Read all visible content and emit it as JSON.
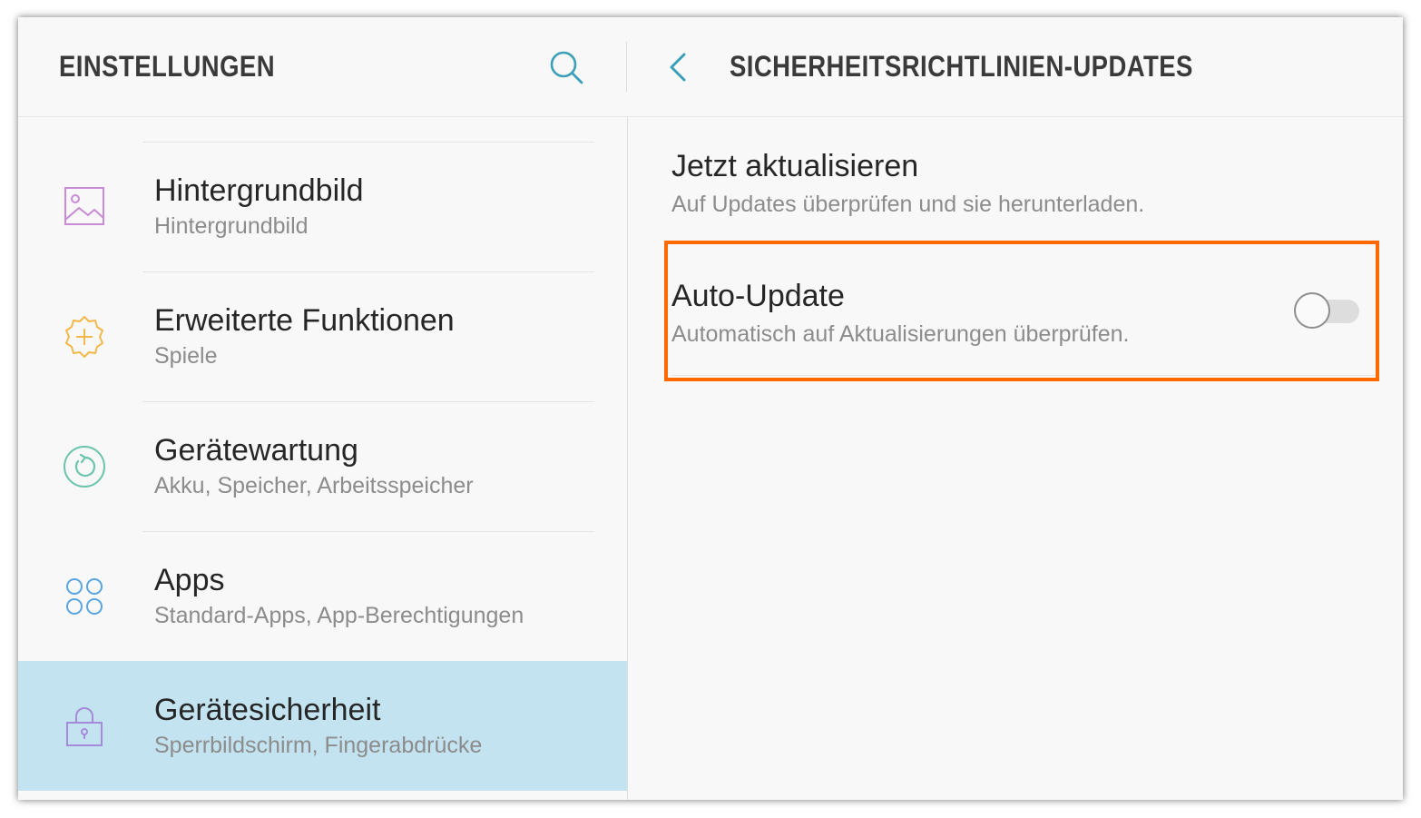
{
  "header": {
    "left_title": "EINSTELLUNGEN",
    "right_title": "SICHERHEITSRICHTLINIEN-UPDATES",
    "search_icon": "search-icon",
    "back_icon": "chevron-left-icon"
  },
  "sidebar": {
    "items": [
      {
        "title": "Hintergrundbild",
        "subtitle": "Hintergrundbild",
        "icon": "wallpaper-icon",
        "icon_color": "#c98ad6",
        "selected": false
      },
      {
        "title": "Erweiterte Funktionen",
        "subtitle": "Spiele",
        "icon": "gear-plus-icon",
        "icon_color": "#f2b84b",
        "selected": false
      },
      {
        "title": "Gerätewartung",
        "subtitle": "Akku, Speicher, Arbeitsspeicher",
        "icon": "device-maintenance-icon",
        "icon_color": "#6cc4ad",
        "selected": false
      },
      {
        "title": "Apps",
        "subtitle": "Standard-Apps, App-Berechtigungen",
        "icon": "apps-icon",
        "icon_color": "#5aa4e0",
        "selected": false
      },
      {
        "title": "Gerätesicherheit",
        "subtitle": "Sperrbildschirm, Fingerabdrücke",
        "icon": "lock-icon",
        "icon_color": "#a58cdb",
        "selected": true
      }
    ]
  },
  "main": {
    "update_now": {
      "title": "Jetzt aktualisieren",
      "subtitle": "Auf Updates überprüfen und sie herunterladen."
    },
    "auto_update": {
      "title": "Auto-Update",
      "subtitle": "Automatisch auf Aktualisierungen überprüfen.",
      "enabled": false
    }
  },
  "colors": {
    "accent": "#3b9fb8",
    "highlight_border": "#ff6a00",
    "selected_background": "#c3e3f0"
  }
}
